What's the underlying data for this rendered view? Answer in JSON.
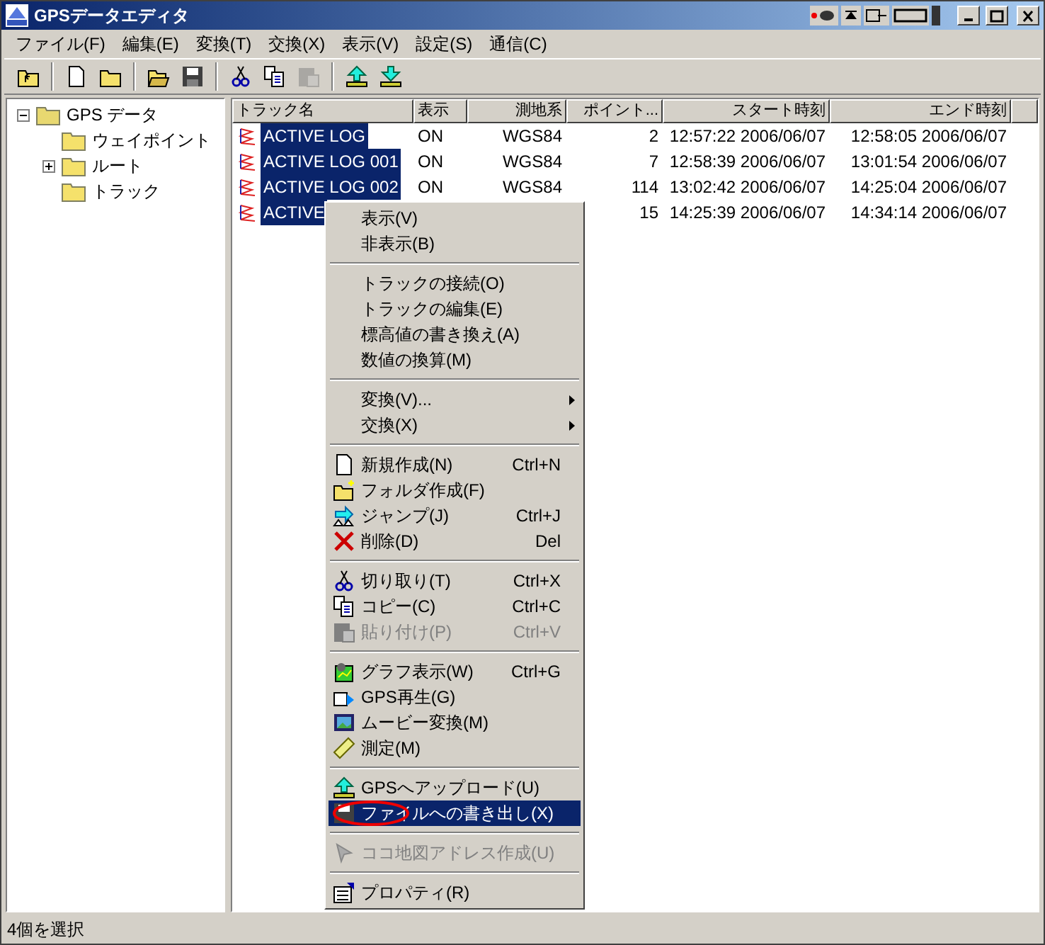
{
  "window": {
    "title": "GPSデータエディタ"
  },
  "menu_bar": [
    "ファイル(F)",
    "編集(E)",
    "変換(T)",
    "交換(X)",
    "表示(V)",
    "設定(S)",
    "通信(C)"
  ],
  "toolbar": [
    {
      "kind": "button",
      "disabled": false
    },
    {
      "kind": "separator"
    },
    {
      "kind": "button",
      "disabled": false
    },
    {
      "kind": "button",
      "disabled": false
    },
    {
      "kind": "separator"
    },
    {
      "kind": "button",
      "disabled": false
    },
    {
      "kind": "button",
      "disabled": false
    },
    {
      "kind": "separator"
    },
    {
      "kind": "button",
      "disabled": false
    },
    {
      "kind": "button",
      "disabled": false
    },
    {
      "kind": "button",
      "disabled": true
    },
    {
      "kind": "separator"
    },
    {
      "kind": "button",
      "disabled": false
    },
    {
      "kind": "button",
      "disabled": false
    }
  ],
  "tree": [
    {
      "label": "GPS データ",
      "expanded": true,
      "children": [
        {
          "label": "ウェイポイント"
        },
        {
          "label": "ルート",
          "expanded": false
        },
        {
          "label": "トラック"
        }
      ]
    }
  ],
  "table": {
    "columns": [
      "トラック名",
      "表示",
      "測地系",
      "ポイント...",
      "スタート時刻",
      "エンド時刻"
    ],
    "rows": [
      {
        "name": "ACTIVE LOG",
        "display": "ON",
        "datum": "WGS84",
        "points": "2",
        "start": "12:57:22 2006/06/07",
        "end": "12:58:05 2006/06/07",
        "selected": true
      },
      {
        "name": "ACTIVE LOG 001",
        "display": "ON",
        "datum": "WGS84",
        "points": "7",
        "start": "12:58:39 2006/06/07",
        "end": "13:01:54 2006/06/07",
        "selected": true
      },
      {
        "name": "ACTIVE LOG 002",
        "display": "ON",
        "datum": "WGS84",
        "points": "114",
        "start": "13:02:42 2006/06/07",
        "end": "14:25:04 2006/06/07",
        "selected": true
      },
      {
        "name": "ACTIVE",
        "points": "15",
        "start": "14:25:39 2006/06/07",
        "end": "14:34:14 2006/06/07",
        "selected": true
      }
    ]
  },
  "context_menu": [
    {
      "kind": "item",
      "label": "表示(V)",
      "disabled": false,
      "selected": false
    },
    {
      "kind": "item",
      "label": "非表示(B)",
      "disabled": false,
      "selected": false
    },
    {
      "kind": "separator"
    },
    {
      "kind": "item",
      "label": "トラックの接続(O)",
      "disabled": false,
      "selected": false
    },
    {
      "kind": "item",
      "label": "トラックの編集(E)",
      "disabled": false,
      "selected": false
    },
    {
      "kind": "item",
      "label": "標高値の書き換え(A)",
      "disabled": false,
      "selected": false
    },
    {
      "kind": "item",
      "label": "数値の換算(M)",
      "disabled": false,
      "selected": false
    },
    {
      "kind": "separator"
    },
    {
      "kind": "submenu",
      "label": "変換(V)...",
      "disabled": false,
      "selected": false
    },
    {
      "kind": "submenu",
      "label": "交換(X)",
      "disabled": false,
      "selected": false
    },
    {
      "kind": "separator"
    },
    {
      "kind": "item",
      "label": "新規作成(N)",
      "shortcut": "Ctrl+N",
      "disabled": false,
      "selected": false
    },
    {
      "kind": "item",
      "label": "フォルダ作成(F)",
      "disabled": false,
      "selected": false
    },
    {
      "kind": "item",
      "label": "ジャンプ(J)",
      "shortcut": "Ctrl+J",
      "disabled": false,
      "selected": false
    },
    {
      "kind": "item",
      "label": "削除(D)",
      "shortcut": "Del",
      "disabled": false,
      "selected": false
    },
    {
      "kind": "separator"
    },
    {
      "kind": "item",
      "label": "切り取り(T)",
      "shortcut": "Ctrl+X",
      "disabled": false,
      "selected": false
    },
    {
      "kind": "item",
      "label": "コピー(C)",
      "shortcut": "Ctrl+C",
      "disabled": false,
      "selected": false
    },
    {
      "kind": "item",
      "label": "貼り付け(P)",
      "shortcut": "Ctrl+V",
      "disabled": true,
      "selected": false
    },
    {
      "kind": "separator"
    },
    {
      "kind": "item",
      "label": "グラフ表示(W)",
      "shortcut": "Ctrl+G",
      "disabled": false,
      "selected": false
    },
    {
      "kind": "item",
      "label": "GPS再生(G)",
      "disabled": false,
      "selected": false
    },
    {
      "kind": "item",
      "label": "ムービー変換(M)",
      "disabled": false,
      "selected": false
    },
    {
      "kind": "item",
      "label": "測定(M)",
      "disabled": false,
      "selected": false
    },
    {
      "kind": "separator"
    },
    {
      "kind": "item",
      "label": "GPSへアップロード(U)",
      "disabled": false,
      "selected": false
    },
    {
      "kind": "item",
      "label": "ファイルへの書き出し(X)",
      "disabled": false,
      "selected": true
    },
    {
      "kind": "separator"
    },
    {
      "kind": "item",
      "label": "ココ地図アドレス作成(U)",
      "disabled": true,
      "selected": false
    },
    {
      "kind": "separator"
    },
    {
      "kind": "item",
      "label": "プロパティ(R)",
      "disabled": false,
      "selected": false
    }
  ],
  "status_bar": {
    "text": "4個を選択"
  }
}
